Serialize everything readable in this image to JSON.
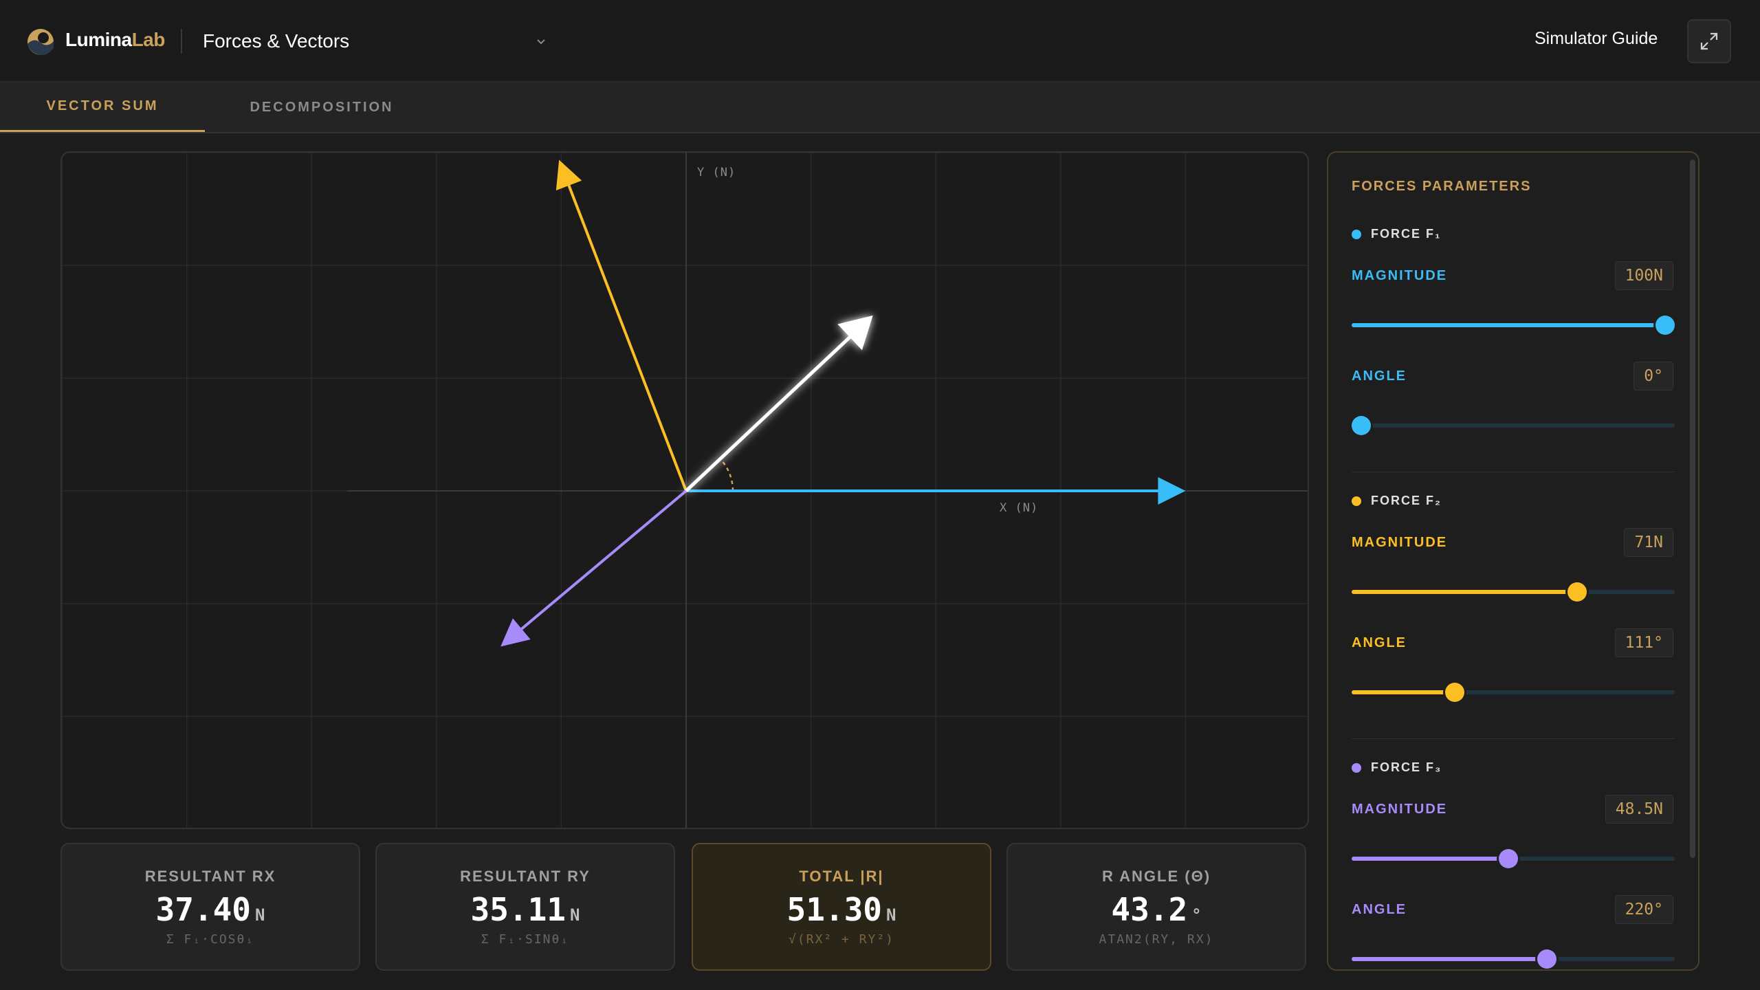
{
  "app": {
    "brand_part1": "Lumina",
    "brand_part2": "Lab",
    "project_title": "Forces & Vectors",
    "guide_label": "Simulator Guide",
    "icons": {
      "logo": "lumina-logo-icon",
      "dropdown": "chevron-down-icon",
      "expand": "expand-icon"
    }
  },
  "tabs": [
    {
      "label": "VECTOR SUM",
      "active": true
    },
    {
      "label": "DECOMPOSITION",
      "active": false
    }
  ],
  "graph": {
    "x_axis_label": "X (N)",
    "y_axis_label": "Y (N)",
    "scale_n_per_grid": 25,
    "vectors": [
      {
        "name": "F1",
        "magnitude": 100,
        "angle_deg": 0,
        "color": "#38bdf8"
      },
      {
        "name": "F2",
        "magnitude": 71,
        "angle_deg": 111,
        "color": "#fbbf24"
      },
      {
        "name": "F3",
        "magnitude": 48.5,
        "angle_deg": 220,
        "color": "#a78bfa"
      },
      {
        "name": "R",
        "magnitude": 51.3,
        "angle_deg": 43.2,
        "color": "#ffffff"
      }
    ]
  },
  "results": [
    {
      "label": "RESULTANT RX",
      "value": "37.40",
      "unit": "N",
      "formula": "Σ Fᵢ·COSθᵢ",
      "highlight": false
    },
    {
      "label": "RESULTANT RY",
      "value": "35.11",
      "unit": "N",
      "formula": "Σ Fᵢ·SINθᵢ",
      "highlight": false
    },
    {
      "label": "TOTAL |R|",
      "value": "51.30",
      "unit": "N",
      "formula": "√(RX² + RY²)",
      "highlight": true
    },
    {
      "label": "R ANGLE (Θ)",
      "value": "43.2",
      "unit": "°",
      "formula": "ATAN2(RY, RX)",
      "highlight": false
    }
  ],
  "params": {
    "title": "FORCES PARAMETERS",
    "forces": [
      {
        "name": "FORCE F₁",
        "color": "#38bdf8",
        "magnitude_label": "MAGNITUDE",
        "magnitude_display": "100N",
        "magnitude_fraction": 1.0,
        "angle_label": "ANGLE",
        "angle_display": "0°",
        "angle_fraction": 0.0
      },
      {
        "name": "FORCE F₂",
        "color": "#fbbf24",
        "magnitude_label": "MAGNITUDE",
        "magnitude_display": "71N",
        "magnitude_fraction": 0.71,
        "angle_label": "ANGLE",
        "angle_display": "111°",
        "angle_fraction": 0.308
      },
      {
        "name": "FORCE F₃",
        "color": "#a78bfa",
        "magnitude_label": "MAGNITUDE",
        "magnitude_display": "48.5N",
        "magnitude_fraction": 0.485,
        "angle_label": "ANGLE",
        "angle_display": "220°",
        "angle_fraction": 0.611
      }
    ]
  }
}
